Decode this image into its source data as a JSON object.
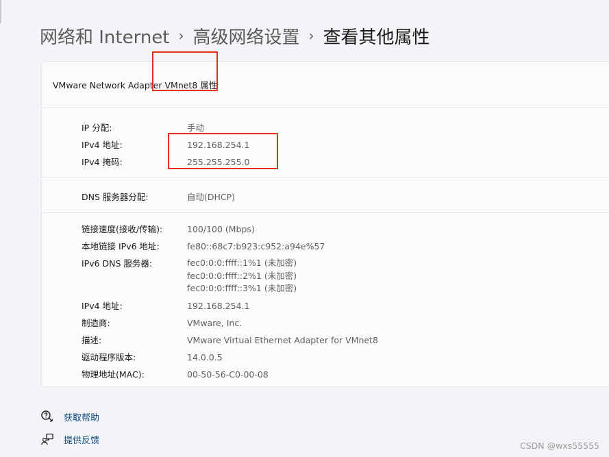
{
  "breadcrumb": {
    "item1": "网络和 Internet",
    "item2": "高级网络设置",
    "current": "查看其他属性",
    "separator": "›"
  },
  "card": {
    "title": "VMware Network Adapter VMnet8 属性",
    "section1": [
      {
        "label": "IP 分配:",
        "value": "手动"
      },
      {
        "label": "IPv4 地址:",
        "value": "192.168.254.1"
      },
      {
        "label": "IPv4 掩码:",
        "value": "255.255.255.0"
      }
    ],
    "section2": [
      {
        "label": "DNS 服务器分配:",
        "value": "自动(DHCP)"
      }
    ],
    "section3": {
      "link_speed": {
        "label": "链接速度(接收/传输):",
        "value": "100/100 (Mbps)"
      },
      "ipv6_link_local": {
        "label": "本地链接 IPv6 地址:",
        "value": "fe80::68c7:b923:c952:a94e%57"
      },
      "ipv6_dns": {
        "label": "IPv6 DNS 服务器:",
        "values": [
          "fec0:0:0:ffff::1%1 (未加密)",
          "fec0:0:0:ffff::2%1 (未加密)",
          "fec0:0:0:ffff::3%1 (未加密)"
        ]
      },
      "ipv4": {
        "label": "IPv4 地址:",
        "value": "192.168.254.1"
      },
      "manufacturer": {
        "label": "制造商:",
        "value": "VMware, Inc."
      },
      "description": {
        "label": "描述:",
        "value": "VMware Virtual Ethernet Adapter for VMnet8"
      },
      "driver_version": {
        "label": "驱动程序版本:",
        "value": "14.0.0.5"
      },
      "mac": {
        "label": "物理地址(MAC):",
        "value": "00-50-56-C0-00-08"
      }
    }
  },
  "links": {
    "help": "获取帮助",
    "feedback": "提供反馈"
  },
  "icons": {
    "help": "help-icon",
    "feedback": "feedback-icon"
  },
  "colors": {
    "annotation": "#e4301f",
    "link": "#0f4a7d"
  },
  "watermark": "CSDN @wxs55555"
}
